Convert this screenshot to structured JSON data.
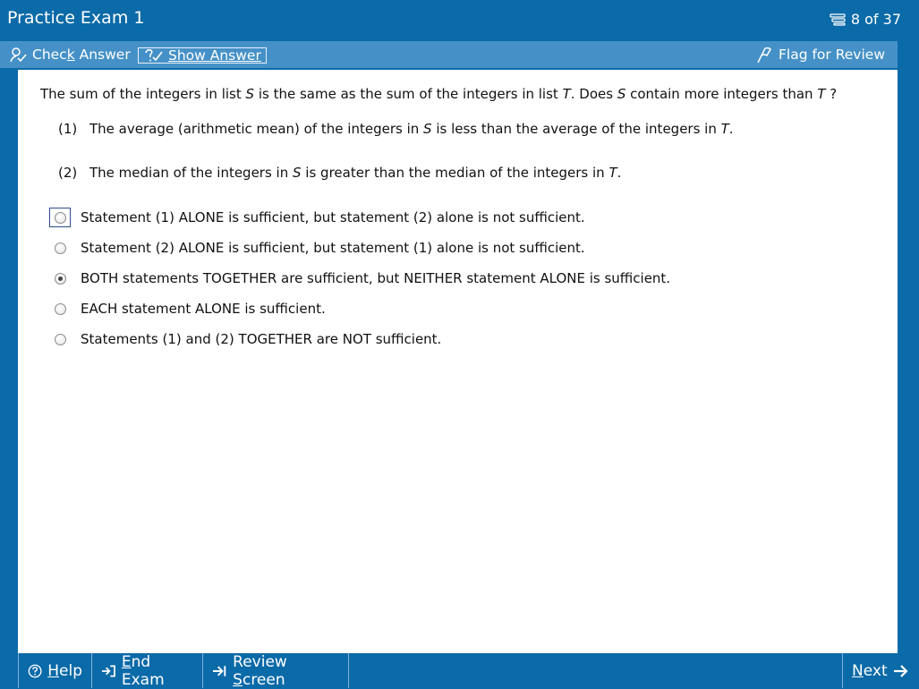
{
  "window": {
    "title": "Practice Exam 1",
    "progress": "8 of 37",
    "progress_icon": "question-list-icon"
  },
  "toolbar": {
    "check_answer": {
      "pre": "Chec",
      "u": "k",
      "post": " Answer",
      "icon": "check-answer-icon"
    },
    "show_answer": {
      "pre": "",
      "u": "S",
      "post": "how Answer",
      "icon": "show-answer-icon"
    },
    "flag_review": {
      "label": "Flag for Review",
      "icon": "flag-icon"
    }
  },
  "question": {
    "stem": {
      "t1": "The sum of the integers in list ",
      "s": "S",
      "t2": " is the same as the sum of the integers in list ",
      "t": "T",
      "t3": ". Does ",
      "s2": "S",
      "t4": " contain more integers than ",
      "t5": "T",
      "t6": " ?"
    },
    "statements": [
      {
        "num": "(1)",
        "a": "The average (arithmetic mean) of the integers in ",
        "v1": "S",
        "b": " is less than the average of the integers in ",
        "v2": "T",
        "c": "."
      },
      {
        "num": "(2)",
        "a": "The median of the integers in ",
        "v1": "S",
        "b": " is greater than the median of the integers in ",
        "v2": "T",
        "c": "."
      }
    ],
    "choices": [
      {
        "label": "Statement (1) ALONE is sufficient, but statement (2) alone is not sufficient.",
        "selected": false,
        "focused": true
      },
      {
        "label": "Statement (2) ALONE is sufficient, but statement (1) alone is not sufficient.",
        "selected": false,
        "focused": false
      },
      {
        "label": "BOTH statements TOGETHER are sufficient, but NEITHER statement ALONE is sufficient.",
        "selected": true,
        "focused": false
      },
      {
        "label": "EACH statement ALONE is sufficient.",
        "selected": false,
        "focused": false
      },
      {
        "label": "Statements (1) and (2) TOGETHER are NOT sufficient.",
        "selected": false,
        "focused": false
      }
    ]
  },
  "bottombar": {
    "help": {
      "u": "H",
      "post": "elp",
      "icon": "help-icon"
    },
    "end_exam": {
      "u": "E",
      "post": "nd Exam",
      "icon": "end-exam-icon"
    },
    "review_screen": {
      "pre": "Review ",
      "u": "S",
      "post": "creen",
      "icon": "review-screen-icon"
    },
    "next": {
      "u": "N",
      "post": "ext",
      "icon": "next-arrow-icon"
    }
  },
  "colors": {
    "frame": "#0b6aa8",
    "toolbar": "#4591c7",
    "content_bg": "#ffffff",
    "text": "#111111"
  }
}
